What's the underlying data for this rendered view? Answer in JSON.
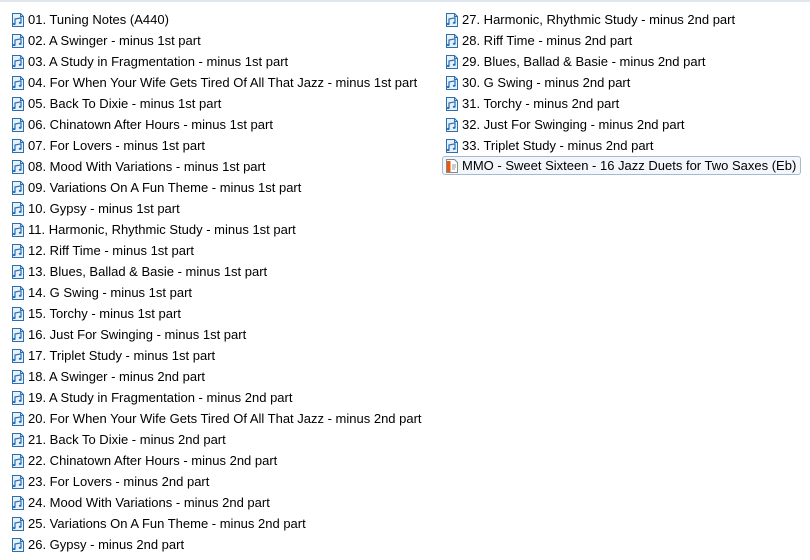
{
  "files": [
    {
      "name": "01. Tuning Notes (A440)",
      "icon": "audio-file-icon"
    },
    {
      "name": "02. A Swinger - minus 1st part",
      "icon": "audio-file-icon"
    },
    {
      "name": "03. A Study in Fragmentation - minus 1st part",
      "icon": "audio-file-icon"
    },
    {
      "name": "04. For When Your Wife Gets Tired Of All That Jazz - minus 1st part",
      "icon": "audio-file-icon"
    },
    {
      "name": "05. Back To Dixie - minus 1st part",
      "icon": "audio-file-icon"
    },
    {
      "name": "06. Chinatown After Hours - minus 1st part",
      "icon": "audio-file-icon"
    },
    {
      "name": "07. For Lovers - minus 1st part",
      "icon": "audio-file-icon"
    },
    {
      "name": "08. Mood With Variations - minus 1st part",
      "icon": "audio-file-icon"
    },
    {
      "name": "09. Variations On A Fun Theme - minus 1st part",
      "icon": "audio-file-icon"
    },
    {
      "name": "10. Gypsy - minus 1st part",
      "icon": "audio-file-icon"
    },
    {
      "name": "11. Harmonic, Rhythmic Study - minus 1st part",
      "icon": "audio-file-icon"
    },
    {
      "name": "12. Riff Time - minus 1st part",
      "icon": "audio-file-icon"
    },
    {
      "name": "13. Blues, Ballad & Basie - minus 1st part",
      "icon": "audio-file-icon"
    },
    {
      "name": "14. G Swing - minus 1st part",
      "icon": "audio-file-icon"
    },
    {
      "name": "15. Torchy - minus 1st part",
      "icon": "audio-file-icon"
    },
    {
      "name": "16. Just For Swinging - minus 1st part",
      "icon": "audio-file-icon"
    },
    {
      "name": "17. Triplet Study - minus 1st part",
      "icon": "audio-file-icon"
    },
    {
      "name": "18. A Swinger - minus 2nd part",
      "icon": "audio-file-icon"
    },
    {
      "name": "19. A Study in Fragmentation - minus 2nd part",
      "icon": "audio-file-icon"
    },
    {
      "name": "20. For When Your Wife Gets Tired Of All That Jazz - minus 2nd part",
      "icon": "audio-file-icon"
    },
    {
      "name": "21. Back To Dixie - minus 2nd part",
      "icon": "audio-file-icon"
    },
    {
      "name": "22. Chinatown After Hours - minus 2nd part",
      "icon": "audio-file-icon"
    },
    {
      "name": "23. For Lovers - minus 2nd part",
      "icon": "audio-file-icon"
    },
    {
      "name": "24. Mood With Variations - minus 2nd part",
      "icon": "audio-file-icon"
    },
    {
      "name": "25. Variations On A Fun Theme - minus 2nd part",
      "icon": "audio-file-icon"
    },
    {
      "name": "26. Gypsy - minus 2nd part",
      "icon": "audio-file-icon"
    },
    {
      "name": "27. Harmonic, Rhythmic Study - minus 2nd part",
      "icon": "audio-file-icon"
    },
    {
      "name": "28. Riff Time - minus 2nd part",
      "icon": "audio-file-icon"
    },
    {
      "name": "29. Blues, Ballad & Basie - minus 2nd part",
      "icon": "audio-file-icon"
    },
    {
      "name": "30. G Swing - minus 2nd part",
      "icon": "audio-file-icon"
    },
    {
      "name": "31. Torchy - minus 2nd part",
      "icon": "audio-file-icon"
    },
    {
      "name": "32. Just For Swinging - minus 2nd part",
      "icon": "audio-file-icon"
    },
    {
      "name": "33. Triplet Study - minus 2nd part",
      "icon": "audio-file-icon"
    },
    {
      "name": "MMO - Sweet Sixteen - 16 Jazz Duets for Two Saxes (Eb)",
      "icon": "pdf-document-icon",
      "selected": true
    }
  ],
  "colors": {
    "audio_icon_stroke": "#2a6fb0",
    "audio_icon_fill": "#e8f1fa",
    "pdf_icon_accent": "#e8590c",
    "selection_border": "#a9b9cc",
    "selection_fill": "#f3f7fb"
  }
}
